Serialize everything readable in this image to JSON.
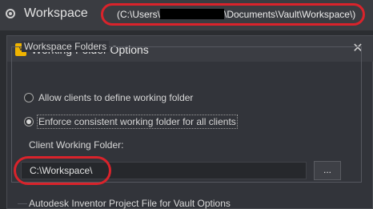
{
  "workspace_bar": {
    "title": "Workspace",
    "path_prefix": "(C:\\Users\\",
    "path_suffix": "\\Documents\\Vault\\Workspace\\)"
  },
  "dialog": {
    "title": "Working Folder Options",
    "close_glyph": "✕",
    "icon_text": "VAULT",
    "group": {
      "label": "Workspace Folders",
      "options": [
        {
          "label": "Allow clients to define working folder",
          "checked": false
        },
        {
          "label": "Enforce consistent working folder for all clients",
          "checked": true
        }
      ],
      "field_label": "Client Working Folder:",
      "field_value": "C:\\Workspace\\",
      "browse_label": "..."
    },
    "next_section_label": "Autodesk Inventor Project File for Vault Options"
  },
  "colors": {
    "annotation_red": "#d9232b",
    "vault_icon": "#f0b400"
  }
}
